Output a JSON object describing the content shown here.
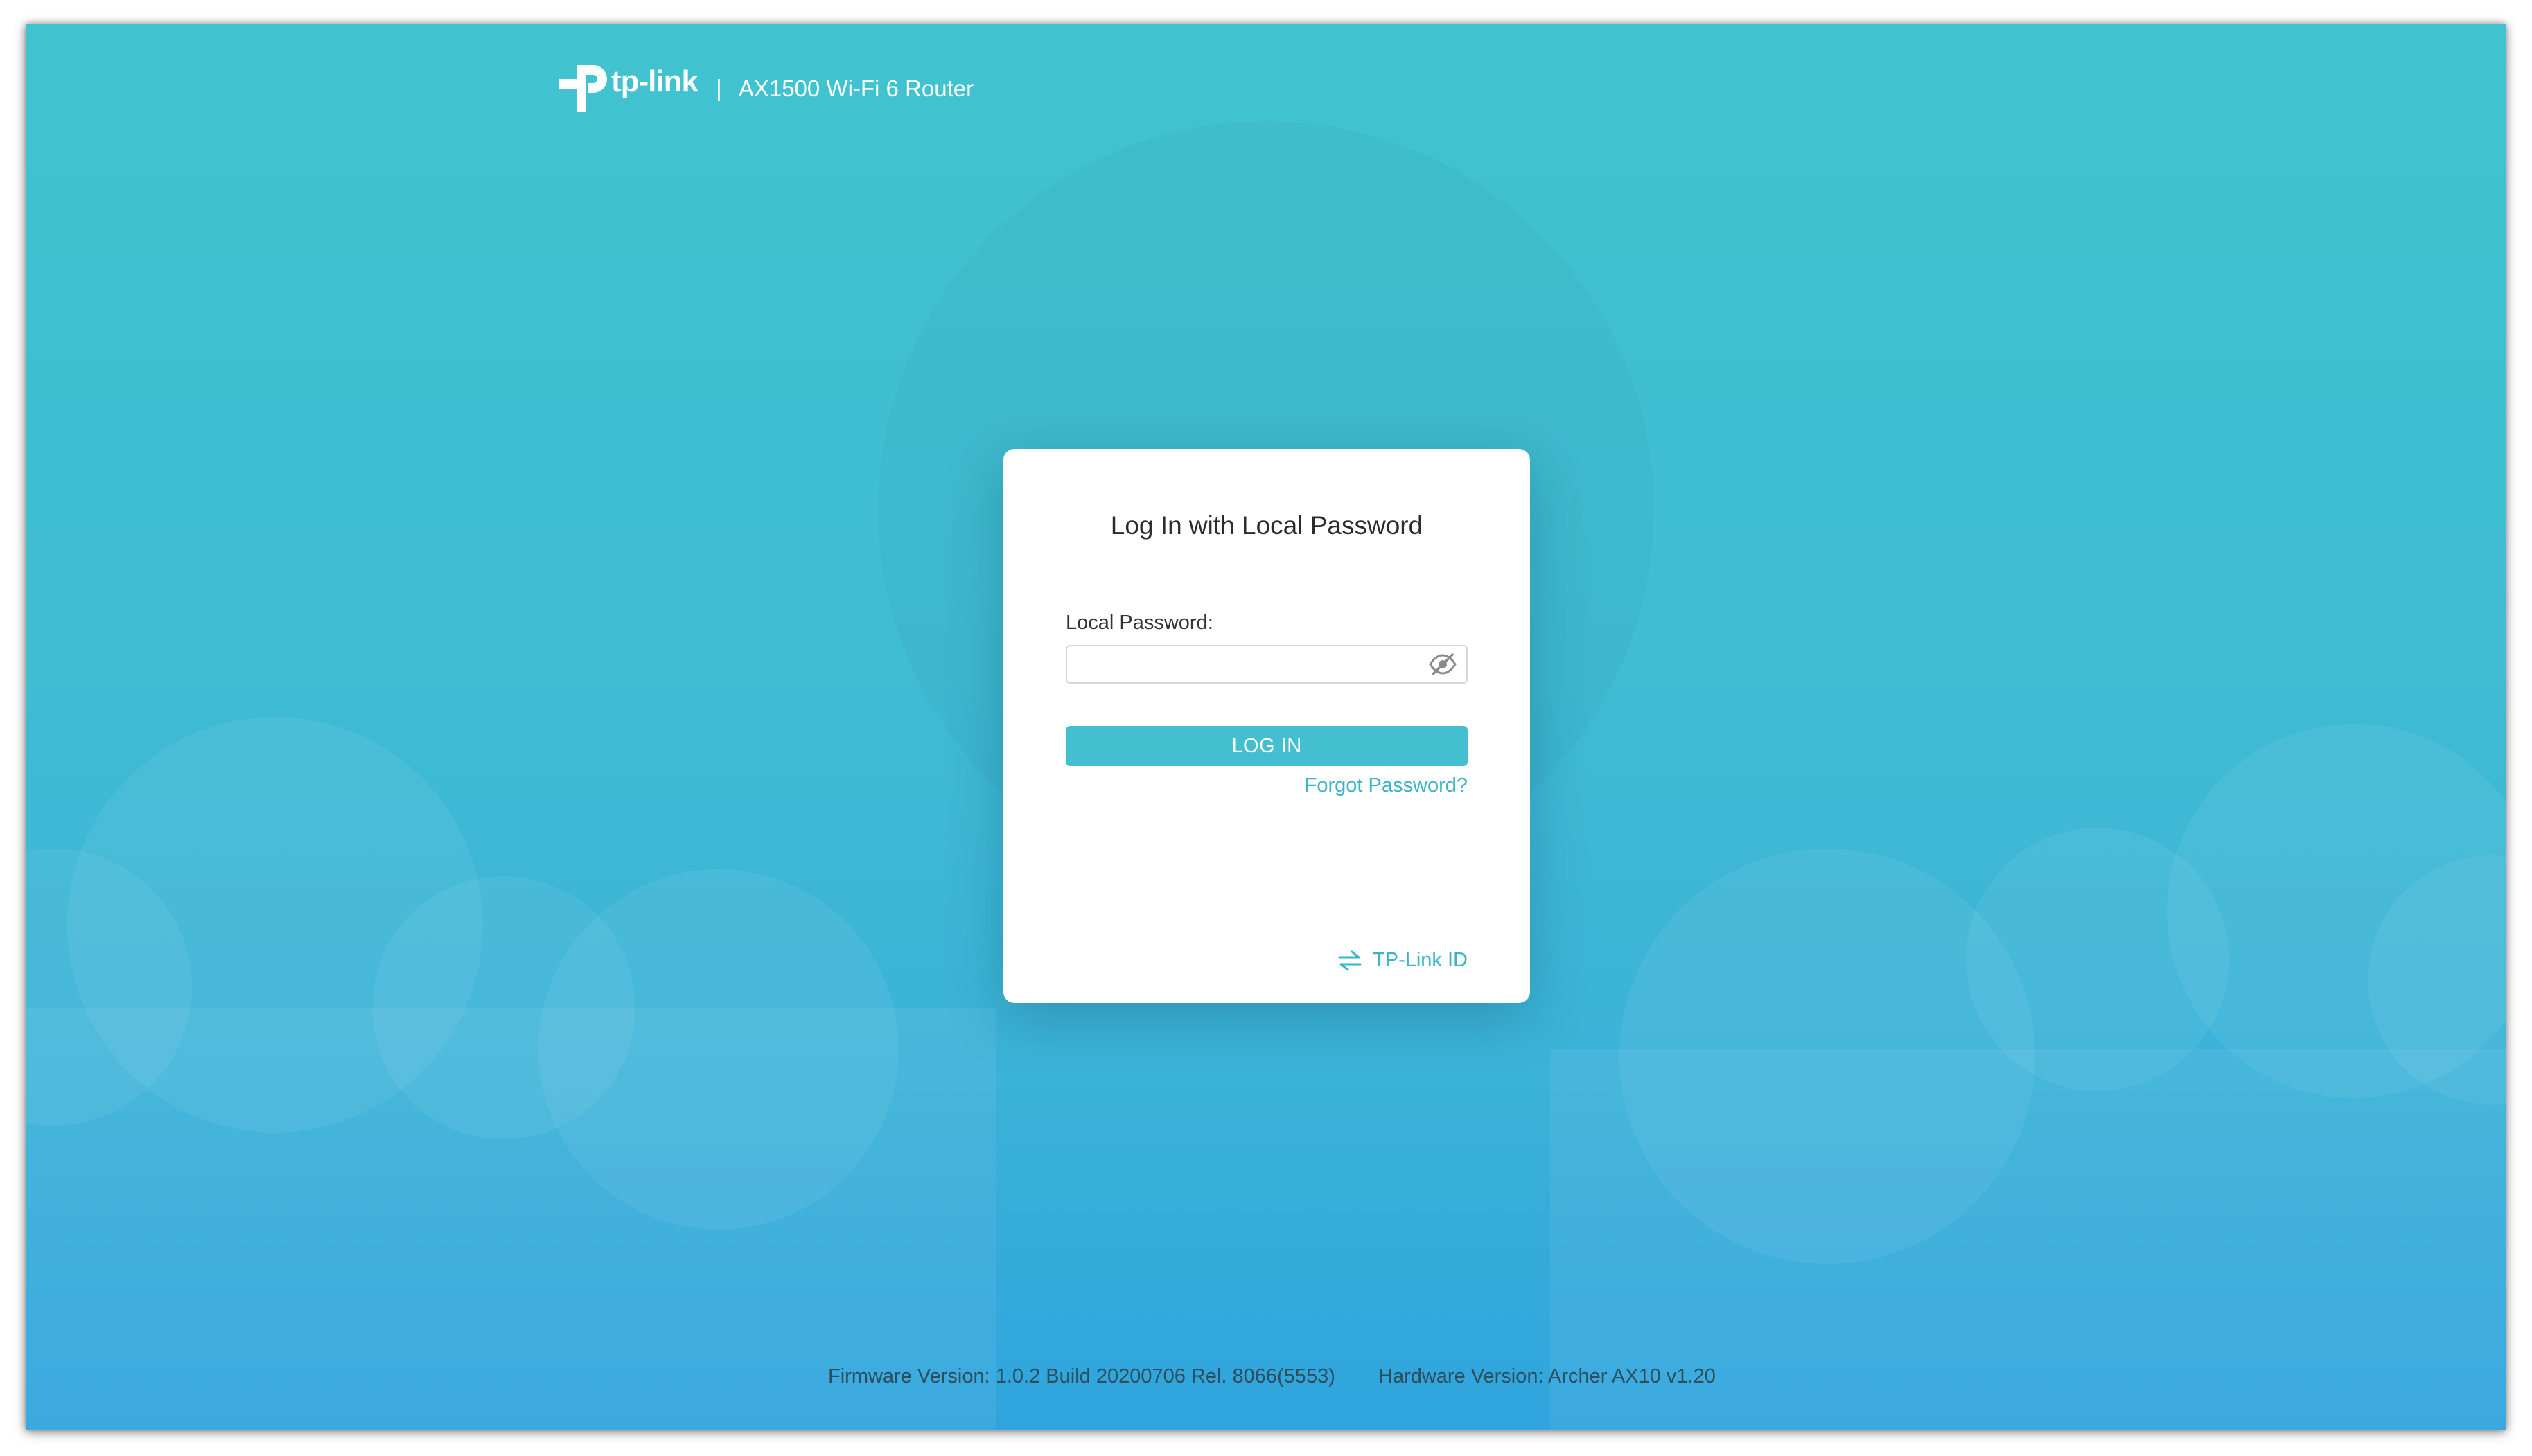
{
  "header": {
    "brand": "tp-link",
    "separator": "|",
    "model": "AX1500 Wi-Fi 6 Router"
  },
  "login": {
    "title": "Log In with Local Password",
    "password_label": "Local Password:",
    "password_value": "",
    "password_placeholder": "",
    "login_button": "LOG IN",
    "forgot_link": "Forgot Password?",
    "tplink_id_link": "TP-Link ID",
    "visibility_icon": "eye-slash-icon",
    "switch_icon": "swap-arrows-icon"
  },
  "footer": {
    "firmware": "Firmware Version: 1.0.2 Build 20200706 Rel. 8066(5553)",
    "hardware": "Hardware Version: Archer AX10 v1.20"
  },
  "colors": {
    "accent": "#44bfcf",
    "link": "#3ab4c6",
    "background_top": "#41c3cf",
    "background_bottom": "#2fa4de"
  }
}
